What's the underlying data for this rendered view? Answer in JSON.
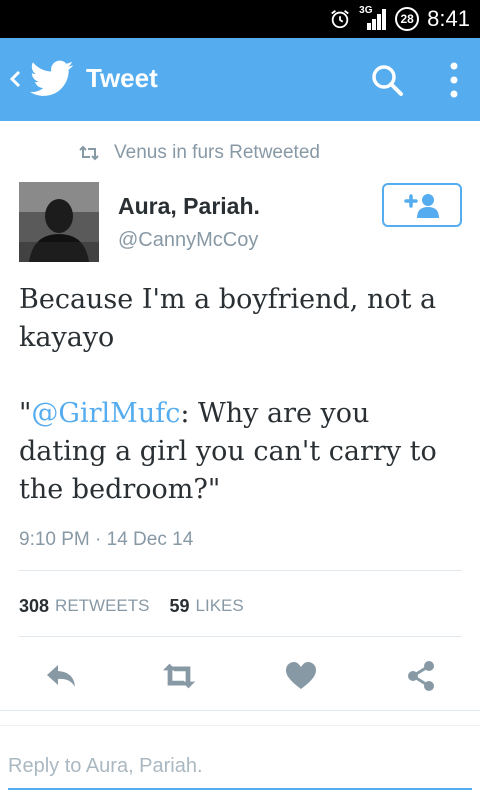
{
  "status_bar": {
    "network": "3G",
    "battery": "28",
    "time": "8:41",
    "icons": [
      "alarm-icon",
      "signal-icon",
      "battery-icon"
    ]
  },
  "header": {
    "title": "Tweet",
    "icons": [
      "back-chevron-icon",
      "twitter-bird-icon",
      "search-icon",
      "overflow-menu-icon"
    ],
    "background": "#55acee"
  },
  "retweet_context": {
    "text": "Venus in furs Retweeted",
    "icon": "retweet-icon"
  },
  "author": {
    "name": "Aura, Pariah.",
    "handle": "@CannyMcCoy",
    "follow_icon": "follow-user-icon"
  },
  "tweet": {
    "line1": "Because I'm a boyfriend, not a kayayo",
    "quote_open": "\"",
    "mention": "@GirlMufc",
    "quote_rest": ": Why are you dating a girl you can't carry to the bedroom?\"",
    "timestamp": "9:10 PM · 14 Dec 14"
  },
  "stats": {
    "retweets_count": "308",
    "retweets_label": "RETWEETS",
    "likes_count": "59",
    "likes_label": "LIKES"
  },
  "actions": {
    "icons": [
      "reply-icon",
      "retweet-icon",
      "like-heart-icon",
      "share-icon"
    ]
  },
  "reply": {
    "placeholder": "Reply to Aura, Pariah."
  },
  "colors": {
    "accent": "#55acee",
    "secondary_text": "#8899a6",
    "action_icon": "#8899a6"
  }
}
